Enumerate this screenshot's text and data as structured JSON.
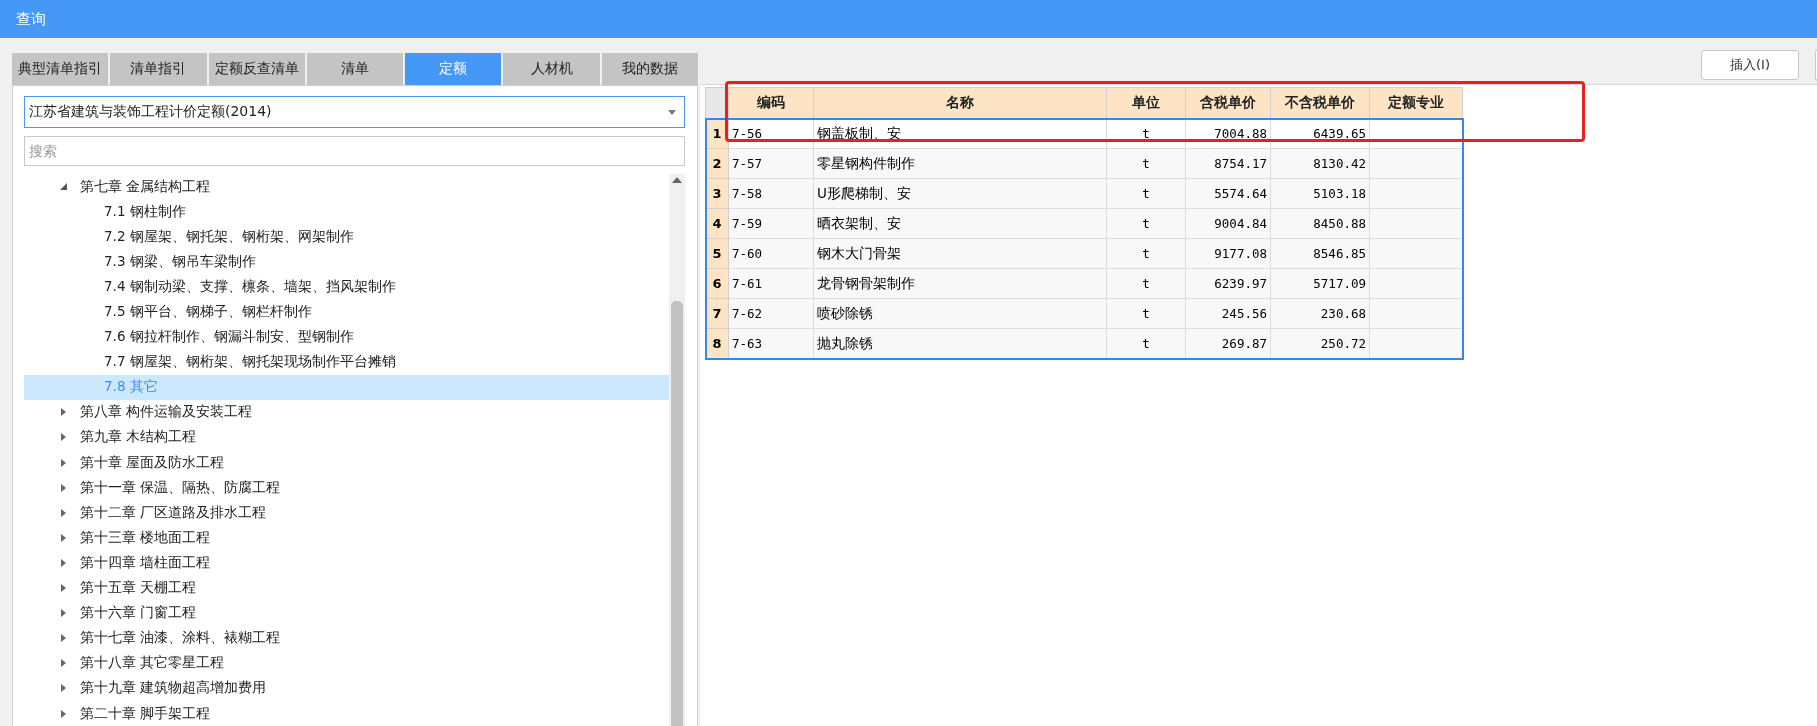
{
  "window": {
    "title": "查询"
  },
  "tabs": [
    {
      "label": "典型清单指引",
      "selected": false
    },
    {
      "label": "清单指引",
      "selected": false
    },
    {
      "label": "定额反查清单",
      "selected": false
    },
    {
      "label": "清单",
      "selected": false
    },
    {
      "label": "定额",
      "selected": true
    },
    {
      "label": "人材机",
      "selected": false
    },
    {
      "label": "我的数据",
      "selected": false
    }
  ],
  "quota_select": {
    "value": "江苏省建筑与装饰工程计价定额(2014)"
  },
  "search": {
    "placeholder": "搜索"
  },
  "tree": [
    {
      "label": "第七章 金属结构工程",
      "expanded": true,
      "selected": false,
      "children": [
        {
          "label": "7.1 钢柱制作",
          "selected": false
        },
        {
          "label": "7.2 钢屋架、钢托架、钢桁架、网架制作",
          "selected": false
        },
        {
          "label": "7.3 钢梁、钢吊车梁制作",
          "selected": false
        },
        {
          "label": "7.4 钢制动梁、支撑、檩条、墙架、挡风架制作",
          "selected": false
        },
        {
          "label": "7.5 钢平台、钢梯子、钢栏杆制作",
          "selected": false
        },
        {
          "label": "7.6 钢拉杆制作、钢漏斗制安、型钢制作",
          "selected": false
        },
        {
          "label": "7.7 钢屋架、钢桁架、钢托架现场制作平台摊销",
          "selected": false
        },
        {
          "label": "7.8 其它",
          "selected": true
        }
      ]
    },
    {
      "label": "第八章 构件运输及安装工程",
      "expanded": false,
      "selected": false
    },
    {
      "label": "第九章 木结构工程",
      "expanded": false,
      "selected": false
    },
    {
      "label": "第十章 屋面及防水工程",
      "expanded": false,
      "selected": false
    },
    {
      "label": "第十一章 保温、隔热、防腐工程",
      "expanded": false,
      "selected": false
    },
    {
      "label": "第十二章 厂区道路及排水工程",
      "expanded": false,
      "selected": false
    },
    {
      "label": "第十三章 楼地面工程",
      "expanded": false,
      "selected": false
    },
    {
      "label": "第十四章 墙柱面工程",
      "expanded": false,
      "selected": false
    },
    {
      "label": "第十五章 天棚工程",
      "expanded": false,
      "selected": false
    },
    {
      "label": "第十六章 门窗工程",
      "expanded": false,
      "selected": false
    },
    {
      "label": "第十七章 油漆、涂料、裱糊工程",
      "expanded": false,
      "selected": false
    },
    {
      "label": "第十八章 其它零星工程",
      "expanded": false,
      "selected": false
    },
    {
      "label": "第十九章 建筑物超高增加费用",
      "expanded": false,
      "selected": false
    },
    {
      "label": "第二十章 脚手架工程",
      "expanded": false,
      "selected": false
    }
  ],
  "toolbar": {
    "buttons": [
      "插入(I)"
    ]
  },
  "table": {
    "header_highlighted": true,
    "columns": [
      "编码",
      "名称",
      "单位",
      "含税单价",
      "不含税单价",
      "定额专业"
    ],
    "rows": [
      {
        "index": "1",
        "code": "7-56",
        "name": "钢盖板制、安",
        "unit": "t",
        "price_tax": "7004.88",
        "price_no_tax": "6439.65"
      },
      {
        "index": "2",
        "code": "7-57",
        "name": "零星钢构件制作",
        "unit": "t",
        "price_tax": "8754.17",
        "price_no_tax": "8130.42"
      },
      {
        "index": "3",
        "code": "7-58",
        "name": "U形爬梯制、安",
        "unit": "t",
        "price_tax": "5574.64",
        "price_no_tax": "5103.18"
      },
      {
        "index": "4",
        "code": "7-59",
        "name": "晒衣架制、安",
        "unit": "t",
        "price_tax": "9004.84",
        "price_no_tax": "8450.88"
      },
      {
        "index": "5",
        "code": "7-60",
        "name": "钢木大门骨架",
        "unit": "t",
        "price_tax": "9177.08",
        "price_no_tax": "8546.85"
      },
      {
        "index": "6",
        "code": "7-61",
        "name": "龙骨钢骨架制作",
        "unit": "t",
        "price_tax": "6239.97",
        "price_no_tax": "5717.09"
      },
      {
        "index": "7",
        "code": "7-62",
        "name": "喷砂除锈",
        "unit": "t",
        "price_tax": "245.56",
        "price_no_tax": "230.68"
      },
      {
        "index": "8",
        "code": "7-63",
        "name": "抛丸除锈",
        "unit": "t",
        "price_tax": "269.87",
        "price_no_tax": "250.72"
      }
    ]
  }
}
